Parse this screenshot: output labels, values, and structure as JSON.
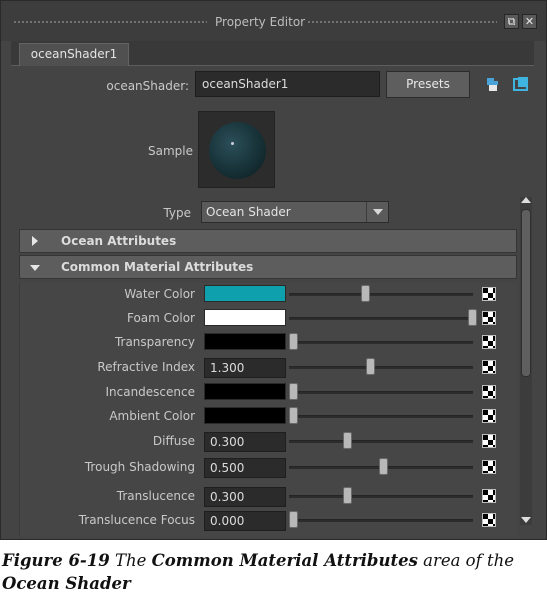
{
  "window": {
    "title": "Property Editor"
  },
  "tab": {
    "label": "oceanShader1"
  },
  "node": {
    "label": "oceanShader:",
    "value": "oceanShader1"
  },
  "presets_label": "Presets",
  "sample_label": "Sample",
  "type": {
    "label": "Type",
    "value": "Ocean Shader"
  },
  "sections": {
    "ocean": "Ocean Attributes",
    "common": "Common Material Attributes"
  },
  "attributes": [
    {
      "label": "Water Color",
      "kind": "color",
      "color": "#0fa0ad",
      "slider": 0.4
    },
    {
      "label": "Foam Color",
      "kind": "color",
      "color": "#ffffff",
      "slider": 1.0
    },
    {
      "label": "Transparency",
      "kind": "color",
      "color": "#000000",
      "slider": 0.0
    },
    {
      "label": "Refractive Index",
      "kind": "number",
      "value": "1.300",
      "slider": 0.43
    },
    {
      "label": "Incandescence",
      "kind": "color",
      "color": "#000000",
      "slider": 0.0
    },
    {
      "label": "Ambient Color",
      "kind": "color",
      "color": "#000000",
      "slider": 0.0
    },
    {
      "label": "Diffuse",
      "kind": "number",
      "value": "0.300",
      "slider": 0.3
    },
    {
      "label": "Trough Shadowing",
      "kind": "number",
      "value": "0.500",
      "slider": 0.5
    },
    {
      "label": "Translucence",
      "kind": "number",
      "value": "0.300",
      "slider": 0.3
    },
    {
      "label": "Translucence Focus",
      "kind": "number",
      "value": "0.000",
      "slider": 0.0
    }
  ],
  "caption": {
    "fig": "Figure 6-19",
    "t1": "The",
    "b1": "Common Material Attributes",
    "t2": "area of the",
    "b2": "Ocean Shader"
  },
  "icons": {
    "float": "float-window-icon",
    "close": "close-icon",
    "copy_tab": "copy-tab-icon",
    "focus": "focus-icon",
    "map": "checker-map-icon"
  }
}
